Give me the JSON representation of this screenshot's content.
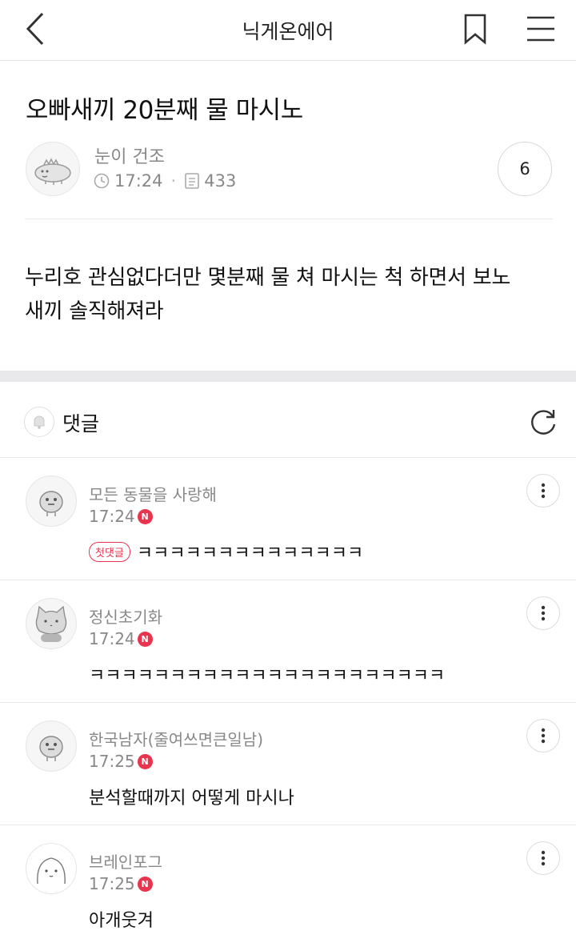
{
  "header": {
    "title": "닉게온에어",
    "back_icon": "chevron-left-icon",
    "bookmark_icon": "bookmark-icon",
    "menu_icon": "hamburger-menu-icon"
  },
  "post": {
    "title": "오빠새끼 20분째 물 마시노",
    "author": "눈이 건조",
    "time": "17:24",
    "views": "433",
    "comment_count": "6",
    "body_line1": "누리호 관심없다더만 몇분째 물 쳐 마시는 척 하면서 보노",
    "body_line2": "새끼 솔직해져라"
  },
  "comments_section": {
    "label": "댓글",
    "refresh_icon": "refresh-icon"
  },
  "comments": [
    {
      "name": "모든 동물을 사랑해",
      "time": "17:24",
      "badge": "N",
      "tag": "첫댓글",
      "text": "ㅋㅋㅋㅋㅋㅋㅋㅋㅋㅋㅋㅋㅋㅋ"
    },
    {
      "name": "정신초기화",
      "time": "17:24",
      "badge": "N",
      "tag": "",
      "text": "ㅋㅋㅋㅋㅋㅋㅋㅋㅋㅋㅋㅋㅋㅋㅋㅋㅋㅋㅋㅋㅋㅋ"
    },
    {
      "name": "한국남자(줄여쓰면큰일남)",
      "time": "17:25",
      "badge": "N",
      "tag": "",
      "text": "분석할때까지 어떻게 마시나"
    },
    {
      "name": "브레인포그",
      "time": "17:25",
      "badge": "N",
      "tag": "",
      "text": "아개웃겨"
    }
  ],
  "colors": {
    "accent_red": "#e8344e",
    "meta_gray": "#888888",
    "divider": "#e6e6e6"
  }
}
